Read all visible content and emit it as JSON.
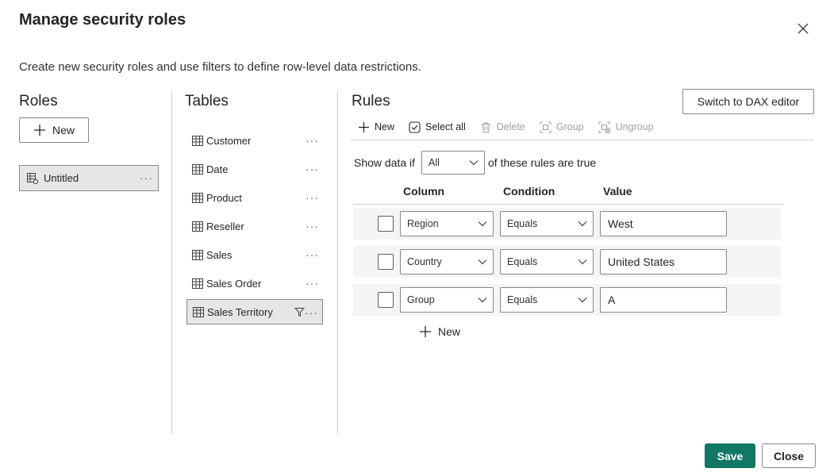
{
  "dialog": {
    "title": "Manage security roles",
    "subtitle": "Create new security roles and use filters to define row-level data restrictions."
  },
  "roles": {
    "heading": "Roles",
    "new_label": "New",
    "items": [
      {
        "label": "Untitled"
      }
    ]
  },
  "tables": {
    "heading": "Tables",
    "items": [
      {
        "label": "Customer"
      },
      {
        "label": "Date"
      },
      {
        "label": "Product"
      },
      {
        "label": "Reseller"
      },
      {
        "label": "Sales"
      },
      {
        "label": "Sales Order"
      },
      {
        "label": "Sales Territory",
        "selected": true,
        "filtered": true
      }
    ]
  },
  "rules": {
    "heading": "Rules",
    "dax_button": "Switch to DAX editor",
    "toolbar": {
      "new_label": "New",
      "select_all_label": "Select all",
      "delete_label": "Delete",
      "group_label": "Group",
      "ungroup_label": "Ungroup"
    },
    "show_prefix": "Show data if",
    "match_mode": "All",
    "show_suffix": "of these rules are true",
    "columns": {
      "column": "Column",
      "condition": "Condition",
      "value": "Value"
    },
    "rows": [
      {
        "column": "Region",
        "condition": "Equals",
        "value": "West"
      },
      {
        "column": "Country",
        "condition": "Equals",
        "value": "United States"
      },
      {
        "column": "Group",
        "condition": "Equals",
        "value": "A"
      }
    ],
    "add_rule_label": "New"
  },
  "footer": {
    "save_label": "Save",
    "close_label": "Close"
  },
  "colors": {
    "primary": "#117865",
    "selected_bg": "#e6e6e6",
    "row_bg": "#f5f5f5"
  }
}
